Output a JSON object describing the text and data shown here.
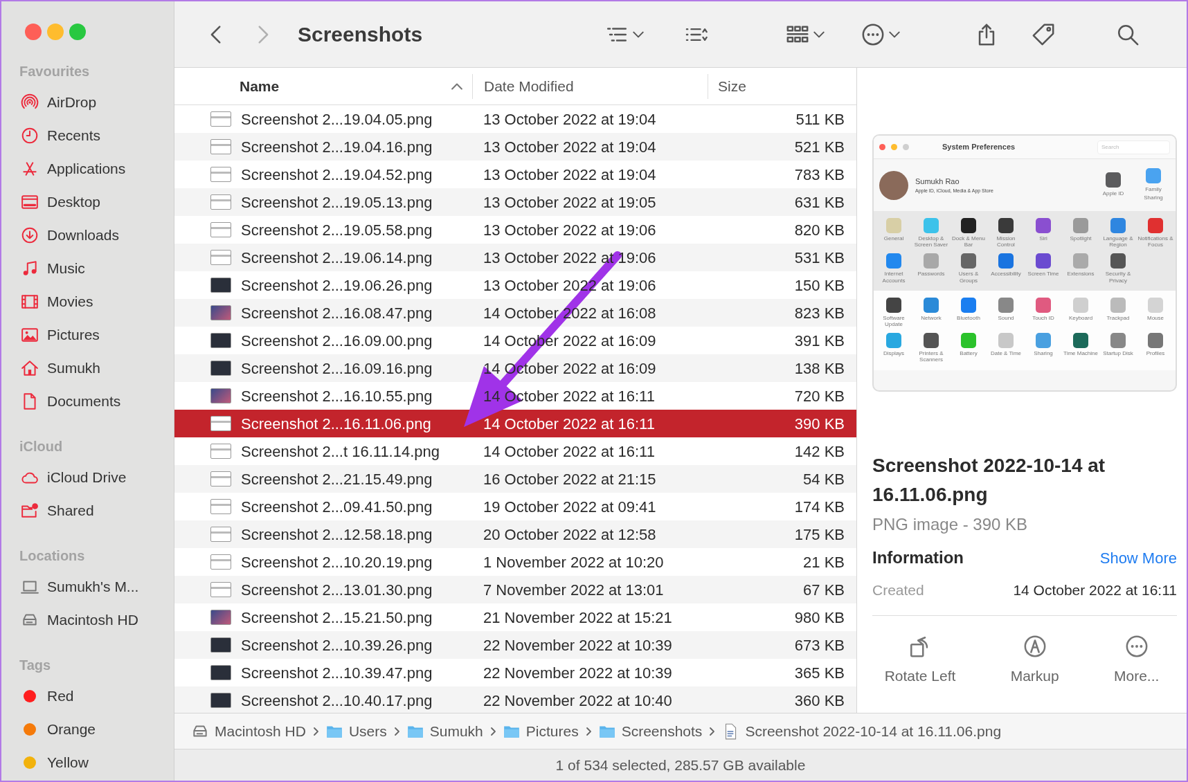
{
  "window": {
    "controls": [
      {
        "kind": "close"
      },
      {
        "kind": "minimize"
      },
      {
        "kind": "zoom"
      }
    ]
  },
  "toolbar": {
    "title": "Screenshots",
    "nav": [
      {
        "kind": "back",
        "disabled": false
      },
      {
        "kind": "forward",
        "disabled": true
      }
    ],
    "tools": [
      {
        "kind": "list-view",
        "menu": true
      },
      {
        "kind": "group",
        "menu": false
      },
      {
        "kind": "gallery",
        "menu": true
      },
      {
        "kind": "more",
        "menu": true
      },
      {
        "kind": "share",
        "menu": false
      },
      {
        "kind": "tag",
        "menu": false
      },
      {
        "kind": "search",
        "menu": false
      }
    ]
  },
  "sidebar": {
    "sections": [
      {
        "heading": "Favourites",
        "items": [
          {
            "label": "AirDrop"
          },
          {
            "label": "Recents"
          },
          {
            "label": "Applications"
          },
          {
            "label": "Desktop"
          },
          {
            "label": "Downloads"
          },
          {
            "label": "Music"
          },
          {
            "label": "Movies"
          },
          {
            "label": "Pictures"
          },
          {
            "label": "Sumukh"
          },
          {
            "label": "Documents"
          }
        ]
      },
      {
        "heading": "iCloud",
        "items": [
          {
            "label": "iCloud Drive"
          },
          {
            "label": "Shared"
          }
        ]
      },
      {
        "heading": "Locations",
        "items": [
          {
            "label": "Sumukh's M..."
          },
          {
            "label": "Macintosh HD"
          }
        ]
      },
      {
        "heading": "Tags",
        "items": [
          {
            "label": "Red",
            "color": "#ff1e1e"
          },
          {
            "label": "Orange",
            "color": "#f57a0a"
          },
          {
            "label": "Yellow",
            "color": "#f2b20c"
          }
        ]
      }
    ]
  },
  "table": {
    "columns": [
      {
        "label": "Name",
        "sorted": true
      },
      {
        "label": "Date Modified",
        "sorted": false
      },
      {
        "label": "Size",
        "sorted": false
      }
    ],
    "rows": [
      {
        "name": "Screenshot 2...19.04.05.png",
        "date": "13 October 2022 at 19:04",
        "size": "511 KB",
        "kind": "light",
        "selected": false
      },
      {
        "name": "Screenshot 2...19.04.16.png",
        "date": "13 October 2022 at 19:04",
        "size": "521 KB",
        "kind": "light",
        "selected": false
      },
      {
        "name": "Screenshot 2...19.04.52.png",
        "date": "13 October 2022 at 19:04",
        "size": "783 KB",
        "kind": "light",
        "selected": false
      },
      {
        "name": "Screenshot 2...19.05.13.png",
        "date": "13 October 2022 at 19:05",
        "size": "631 KB",
        "kind": "light",
        "selected": false
      },
      {
        "name": "Screenshot 2...19.05.58.png",
        "date": "13 October 2022 at 19:06",
        "size": "820 KB",
        "kind": "light",
        "selected": false
      },
      {
        "name": "Screenshot 2...19.06.14.png",
        "date": "13 October 2022 at 19:06",
        "size": "531 KB",
        "kind": "light",
        "selected": false
      },
      {
        "name": "Screenshot 2...19.06.26.png",
        "date": "13 October 2022 at 19:06",
        "size": "150 KB",
        "kind": "dark",
        "selected": false
      },
      {
        "name": "Screenshot 2...16.08.47.png",
        "date": "14 October 2022 at 16:08",
        "size": "823 KB",
        "kind": "photo",
        "selected": false
      },
      {
        "name": "Screenshot 2...16.09.00.png",
        "date": "14 October 2022 at 16:09",
        "size": "391 KB",
        "kind": "dark",
        "selected": false
      },
      {
        "name": "Screenshot 2...16.09.16.png",
        "date": "14 October 2022 at 16:09",
        "size": "138 KB",
        "kind": "dark",
        "selected": false
      },
      {
        "name": "Screenshot 2...16.10.55.png",
        "date": "14 October 2022 at 16:11",
        "size": "720 KB",
        "kind": "photo",
        "selected": false
      },
      {
        "name": "Screenshot 2...16.11.06.png",
        "date": "14 October 2022 at 16:11",
        "size": "390 KB",
        "kind": "light",
        "selected": true
      },
      {
        "name": "Screenshot 2...t 16.11.14.png",
        "date": "14 October 2022 at 16:11",
        "size": "142 KB",
        "kind": "light",
        "selected": false
      },
      {
        "name": "Screenshot 2...21.15.49.png",
        "date": "16 October 2022 at 21:15",
        "size": "54 KB",
        "kind": "light",
        "selected": false
      },
      {
        "name": "Screenshot 2...09.41.50.png",
        "date": "19 October 2022 at 09:41",
        "size": "174 KB",
        "kind": "light",
        "selected": false
      },
      {
        "name": "Screenshot 2...12.58.18.png",
        "date": "20 October 2022 at 12:58",
        "size": "175 KB",
        "kind": "light",
        "selected": false
      },
      {
        "name": "Screenshot 2...10.20.19.png",
        "date": "1 November 2022 at 10:20",
        "size": "21 KB",
        "kind": "light",
        "selected": false
      },
      {
        "name": "Screenshot 2...13.01.30.png",
        "date": "7 November 2022 at 13:01",
        "size": "67 KB",
        "kind": "light",
        "selected": false
      },
      {
        "name": "Screenshot 2...15.21.50.png",
        "date": "21 November 2022 at 15:21",
        "size": "980 KB",
        "kind": "photo",
        "selected": false
      },
      {
        "name": "Screenshot 2...10.39.26.png",
        "date": "22 November 2022 at 10:39",
        "size": "673 KB",
        "kind": "dark",
        "selected": false
      },
      {
        "name": "Screenshot 2...10.39.47.png",
        "date": "22 November 2022 at 10:39",
        "size": "365 KB",
        "kind": "dark",
        "selected": false
      },
      {
        "name": "Screenshot 2...10.40.17.png",
        "date": "22 November 2022 at 10:40",
        "size": "360 KB",
        "kind": "dark",
        "selected": false
      }
    ]
  },
  "preview": {
    "image": {
      "title": "System Preferences",
      "search_placeholder": "Search",
      "user_name": "Sumukh Rao",
      "user_subtitle": "Apple ID, iCloud, Media & App Store",
      "account_items": [
        {
          "label": "Apple ID",
          "color": "#5c5c5e"
        },
        {
          "label": "Family Sharing",
          "color": "#4aa3f0"
        }
      ],
      "sections": [
        {
          "shaded": true,
          "panes": [
            {
              "label": "General",
              "color": "#d8cfa6"
            },
            {
              "label": "Desktop & Screen Saver",
              "color": "#3cc2ea"
            },
            {
              "label": "Dock & Menu Bar",
              "color": "#222222"
            },
            {
              "label": "Mission Control",
              "color": "#3a3a3a"
            },
            {
              "label": "Siri",
              "color": "#8a4fd0"
            },
            {
              "label": "Spotlight",
              "color": "#9a9a9a"
            },
            {
              "label": "Language & Region",
              "color": "#2f86e0"
            },
            {
              "label": "Notifications & Focus",
              "color": "#e03030"
            },
            {
              "label": "Internet Accounts",
              "color": "#2288ee"
            },
            {
              "label": "Passwords",
              "color": "#a8a8a8"
            },
            {
              "label": "Users & Groups",
              "color": "#666666"
            },
            {
              "label": "Accessibility",
              "color": "#1a74e0"
            },
            {
              "label": "Screen Time",
              "color": "#6b4bd0"
            },
            {
              "label": "Extensions",
              "color": "#aaaaaa"
            },
            {
              "label": "Security & Privacy",
              "color": "#555555"
            }
          ]
        },
        {
          "shaded": false,
          "panes": [
            {
              "label": "Software Update",
              "color": "#444444"
            },
            {
              "label": "Network",
              "color": "#2a8ad8"
            },
            {
              "label": "Bluetooth",
              "color": "#1a7ef0"
            },
            {
              "label": "Sound",
              "color": "#888888"
            },
            {
              "label": "Touch ID",
              "color": "#e05a80"
            },
            {
              "label": "Keyboard",
              "color": "#cfcfcf"
            },
            {
              "label": "Trackpad",
              "color": "#bbbbbb"
            },
            {
              "label": "Mouse",
              "color": "#d4d4d4"
            },
            {
              "label": "Displays",
              "color": "#29a8e0"
            },
            {
              "label": "Printers & Scanners",
              "color": "#555555"
            },
            {
              "label": "Battery",
              "color": "#2bc22b"
            },
            {
              "label": "Date & Time",
              "color": "#c8c8c8"
            },
            {
              "label": "Sharing",
              "color": "#4aa0e0"
            },
            {
              "label": "Time Machine",
              "color": "#1c6a5a"
            },
            {
              "label": "Startup Disk",
              "color": "#888888"
            },
            {
              "label": "Profiles",
              "color": "#777777"
            }
          ]
        }
      ]
    },
    "title": "Screenshot 2022-10-14 at 16.11.06.png",
    "subtitle": "PNG image - 390 KB",
    "info_heading": "Information",
    "show_more": "Show More",
    "fields": [
      {
        "label": "Created",
        "value": "14 October 2022 at 16:11"
      }
    ],
    "actions": [
      {
        "label": "Rotate Left",
        "kind": "rotate"
      },
      {
        "label": "Markup",
        "kind": "markup"
      },
      {
        "label": "More...",
        "kind": "more"
      }
    ]
  },
  "path_bar": [
    {
      "label": "Macintosh HD"
    },
    {
      "label": "Users"
    },
    {
      "label": "Sumukh"
    },
    {
      "label": "Pictures"
    },
    {
      "label": "Screenshots"
    },
    {
      "label": "Screenshot 2022-10-14 at 16.11.06.png"
    }
  ],
  "status_bar": "1 of 534 selected, 285.57 GB available"
}
